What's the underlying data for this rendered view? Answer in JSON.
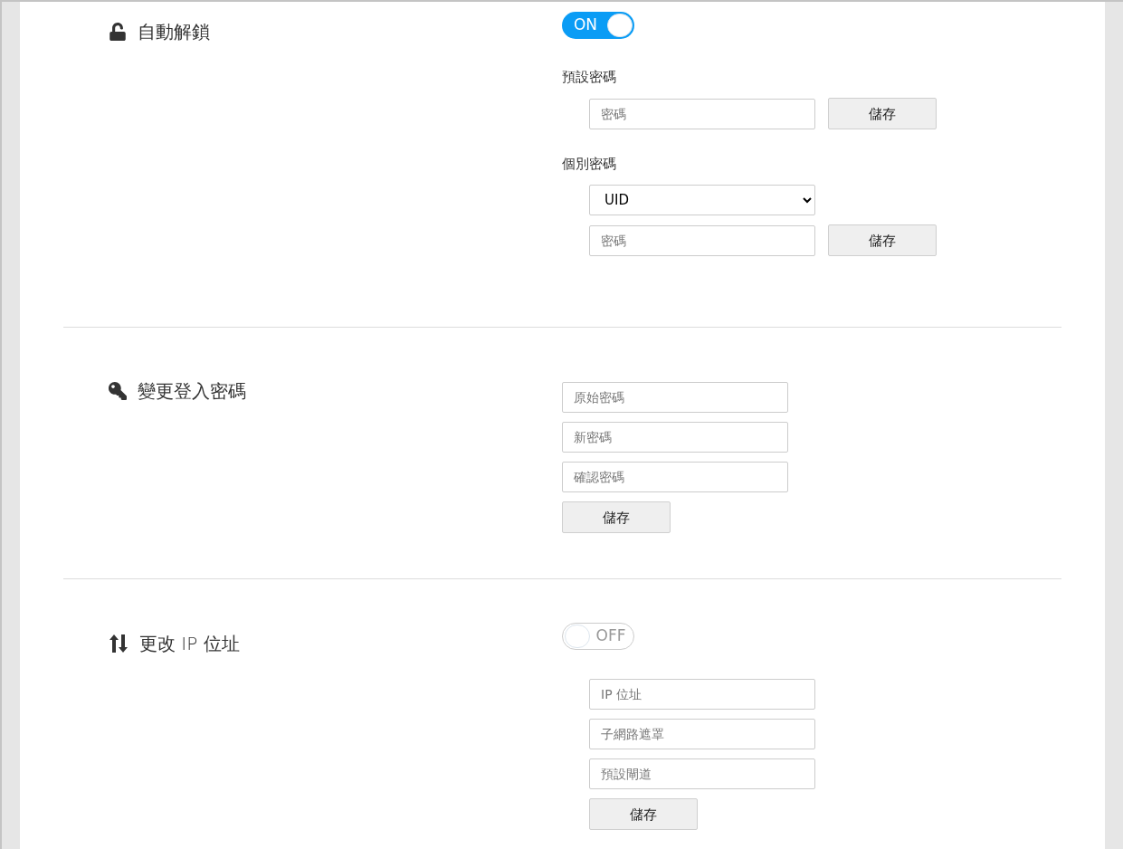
{
  "sections": [
    {
      "kind": "unlock",
      "title": "自動解鎖",
      "toggle": {
        "on": true,
        "label": "ON"
      },
      "items": [
        {
          "kind": "label",
          "text": "預設密碼"
        },
        {
          "kind": "field",
          "placeholder": "密碼",
          "button": "儲存"
        },
        {
          "kind": "label",
          "text": "個別密碼"
        },
        {
          "kind": "select",
          "value": "UID"
        },
        {
          "kind": "field",
          "placeholder": "密碼",
          "button": "儲存"
        }
      ]
    },
    {
      "kind": "password",
      "title": "變更登入密碼",
      "items": [
        {
          "kind": "field",
          "placeholder": "原始密碼"
        },
        {
          "kind": "field",
          "placeholder": "新密碼"
        },
        {
          "kind": "field",
          "placeholder": "確認密碼"
        },
        {
          "kind": "button",
          "label": "儲存"
        }
      ]
    },
    {
      "kind": "network",
      "title": "更改 IP 位址",
      "toggle": {
        "on": false,
        "label": "OFF"
      },
      "items": [
        {
          "kind": "field",
          "placeholder": "IP 位址"
        },
        {
          "kind": "field",
          "placeholder": "子網路遮罩"
        },
        {
          "kind": "field",
          "placeholder": "預設閘道"
        },
        {
          "kind": "button",
          "label": "儲存"
        }
      ]
    }
  ]
}
